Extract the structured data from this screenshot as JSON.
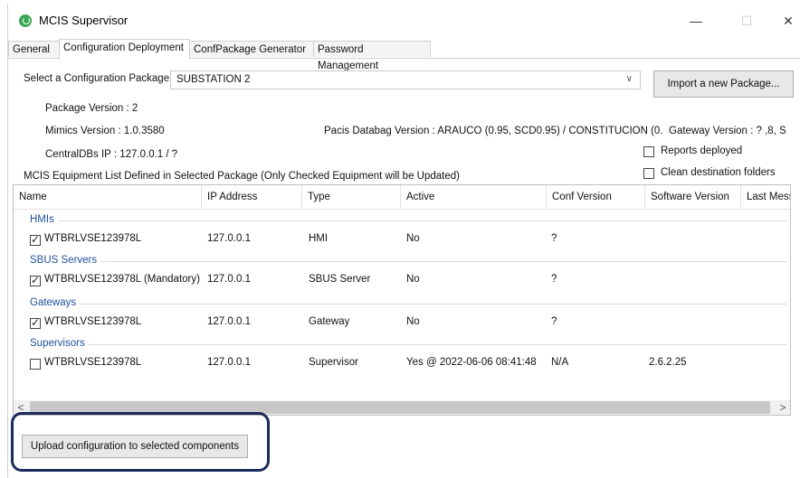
{
  "window": {
    "title": "MCIS Supervisor",
    "controls": {
      "minimize": "—",
      "maximize": "☐",
      "close": "✕"
    }
  },
  "tabs": [
    "General",
    "Configuration Deployment",
    "ConfPackage Generator",
    "Password Management"
  ],
  "package": {
    "select_label": "Select a Configuration Package",
    "selected": "SUBSTATION 2",
    "import_button": "Import a new Package...",
    "package_version": "Package Version : 2",
    "mimics_version": "Mimics Version : 1.0.3580",
    "pacis_databag": "Pacis Databag Version : ARAUCO (0.95, SCD0.95) / CONSTITUCION (0.",
    "gateway_version": "Gateway Version : ? ,8, S",
    "central_dbs_ip": "CentralDBs IP : 127.0.0.1 / ?",
    "reports_deployed": "Reports deployed",
    "clean_destination": "Clean destination folders"
  },
  "equipment": {
    "caption": "MCIS Equipment List Defined in Selected Package (Only Checked Equipment will be Updated)",
    "columns": [
      "Name",
      "IP Address",
      "Type",
      "Active",
      "Conf Version",
      "Software Version",
      "Last Messa"
    ],
    "groups": [
      {
        "name": "HMIs",
        "rows": [
          {
            "checked": true,
            "name": "WTBRLVSE123978L",
            "ip": "127.0.0.1",
            "type": "HMI",
            "active": "No",
            "conf": "?",
            "software": ""
          }
        ]
      },
      {
        "name": "SBUS Servers",
        "rows": [
          {
            "checked": true,
            "name": "WTBRLVSE123978L (Mandatory)",
            "ip": "127.0.0.1",
            "type": "SBUS Server",
            "active": "No",
            "conf": "?",
            "software": ""
          }
        ]
      },
      {
        "name": "Gateways",
        "rows": [
          {
            "checked": true,
            "name": "WTBRLVSE123978L",
            "ip": "127.0.0.1",
            "type": "Gateway",
            "active": "No",
            "conf": "?",
            "software": ""
          }
        ]
      },
      {
        "name": "Supervisors",
        "rows": [
          {
            "checked": false,
            "name": "WTBRLVSE123978L",
            "ip": "127.0.0.1",
            "type": "Supervisor",
            "active": "Yes @ 2022-06-06 08:41:48",
            "conf": "N/A",
            "software": "2.6.2.25"
          }
        ]
      }
    ],
    "scroll_left": "<",
    "scroll_right": ">"
  },
  "upload_button": "Upload configuration to selected components",
  "colors": {
    "group_header": "#1f4f9b",
    "highlight_border": "#1b2a5a"
  }
}
